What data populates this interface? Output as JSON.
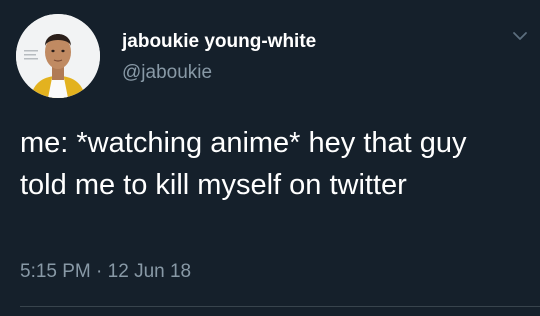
{
  "tweet": {
    "author": {
      "display_name": "jaboukie young-white",
      "handle": "@jaboukie",
      "avatar_icon": "profile-photo"
    },
    "text": "me: *watching anime* hey that guy told me to kill myself on twitter",
    "time": "5:15 PM",
    "separator": " · ",
    "date": "12 Jun 18",
    "menu_icon": "chevron-down-icon"
  },
  "colors": {
    "background": "#15202b",
    "primary_text": "#ffffff",
    "secondary_text": "#8899a6",
    "divider": "#38444d"
  }
}
